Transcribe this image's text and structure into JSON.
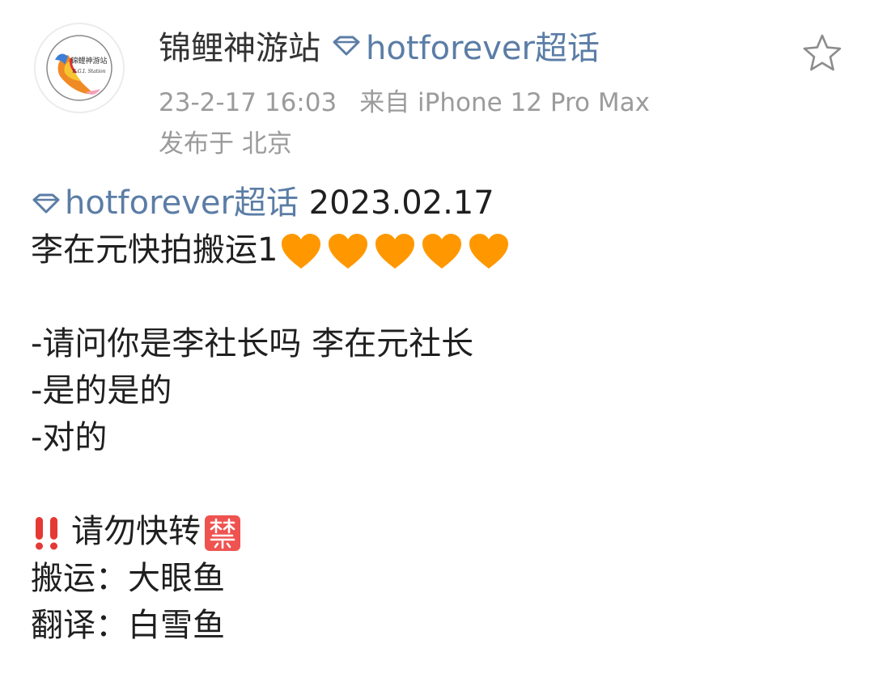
{
  "post": {
    "author_name": "锦鲤神游站",
    "avatar_text": "锦鲤神游站",
    "avatar_subtext": "K.G.I. Station",
    "topic_label": "hotforever超话",
    "timestamp": "23-2-17 16:03",
    "source": "来自 iPhone 12 Pro Max",
    "location": "发布于 北京",
    "icons": {
      "favorite": "star-outline-icon",
      "topic": "diamond-icon",
      "heart": "orange-heart-emoji",
      "warning": "double-exclamation-emoji",
      "forbidden": "prohibited-emoji"
    },
    "colors": {
      "topic_link": "#5b7da6",
      "meta_text": "#9b9b9b",
      "heart": "#ff9800",
      "warning": "#e53935"
    }
  },
  "body": {
    "topic_tag": "hotforever超话",
    "date": " 2023.02.17",
    "title": "李在元快拍搬运1",
    "heart_count": 5,
    "dialogue": [
      "-请问你是李社长吗 李在元社长",
      "-是的是的",
      "-对的"
    ],
    "notice": "请勿快转",
    "credits": [
      "搬运：大眼鱼",
      "翻译：白雪鱼"
    ]
  }
}
